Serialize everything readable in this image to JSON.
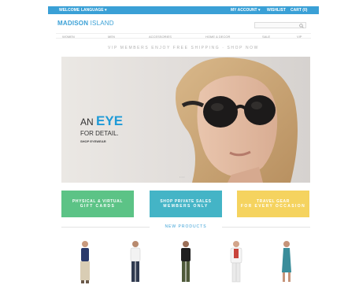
{
  "top_bar": {
    "left_1": "WELCOME",
    "left_2": "LANGUAGE ▾",
    "right_1": "MY ACCOUNT ▾",
    "right_2": "WISHLIST",
    "right_3": "CART (0)"
  },
  "header": {
    "logo_bold": "MADISON",
    "logo_light": " ISLAND",
    "search_placeholder": ""
  },
  "nav": {
    "items": [
      "WOMEN",
      "MEN",
      "ACCESSORIES",
      "HOME & DECOR",
      "SALE",
      "VIP"
    ]
  },
  "promo_text": "VIP MEMBERS ENJOY FREE SHIPPING · SHOP NOW",
  "hero": {
    "line1_prefix": "AN ",
    "line1_big": "EYE",
    "line2": "FOR DETAIL.",
    "line3": "SHOP EYEWEAR",
    "dots": "• • •"
  },
  "tiles": [
    {
      "line1": "PHYSICAL & VIRTUAL",
      "line2": "GIFT CARDS"
    },
    {
      "line1": "SHOP PRIVATE SALES",
      "line2": "MEMBERS ONLY"
    },
    {
      "line1": "TRAVEL GEAR",
      "line2": "FOR EVERY OCCASION"
    }
  ],
  "new_products_title": "NEW PRODUCTS",
  "colors": {
    "brand_blue": "#3aa0d6",
    "tile_green": "#5cc386",
    "tile_teal": "#44b4c6",
    "tile_yellow": "#f5d35f"
  }
}
